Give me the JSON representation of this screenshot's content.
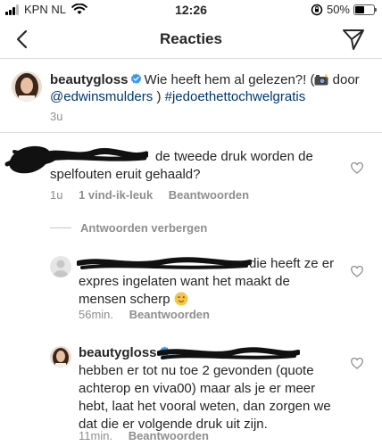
{
  "status_bar": {
    "carrier": "KPN NL",
    "time": "12:26",
    "battery": "50%",
    "battery_level": 0.5
  },
  "nav": {
    "title": "Reacties"
  },
  "caption": {
    "username": "beautygloss",
    "text_before": "Wie heeft hem al gelezen?! (",
    "text_door": " door",
    "mention": "@edwinsmulders",
    "close_paren": " )",
    "hashtag": "#jedoethettochwelgratis",
    "age": "3u"
  },
  "comment1": {
    "text": "de tweede druk worden de spelfouten eruit gehaald?",
    "age": "1u",
    "likes": "1 vind-ik-leuk",
    "reply": "Beantwoorden"
  },
  "replies_toggle": {
    "label": "Antwoorden verbergen"
  },
  "reply1": {
    "text": "die heeft ze er expres ingelaten want het maakt de mensen scherp",
    "age": "56min.",
    "reply": "Beantwoorden"
  },
  "reply2": {
    "username": "beautygloss",
    "text": "hebben er tot nu toe 2 gevonden (quote achterop en viva00) maar als je er meer hebt, laat het vooral weten, dan zorgen we dat die er volgende druk uit zijn.",
    "age": "11min.",
    "reply": "Beantwoorden"
  },
  "colors": {
    "text": "#262626",
    "muted": "#8e8e8e",
    "link": "#00376b",
    "verified": "#3897f0"
  }
}
